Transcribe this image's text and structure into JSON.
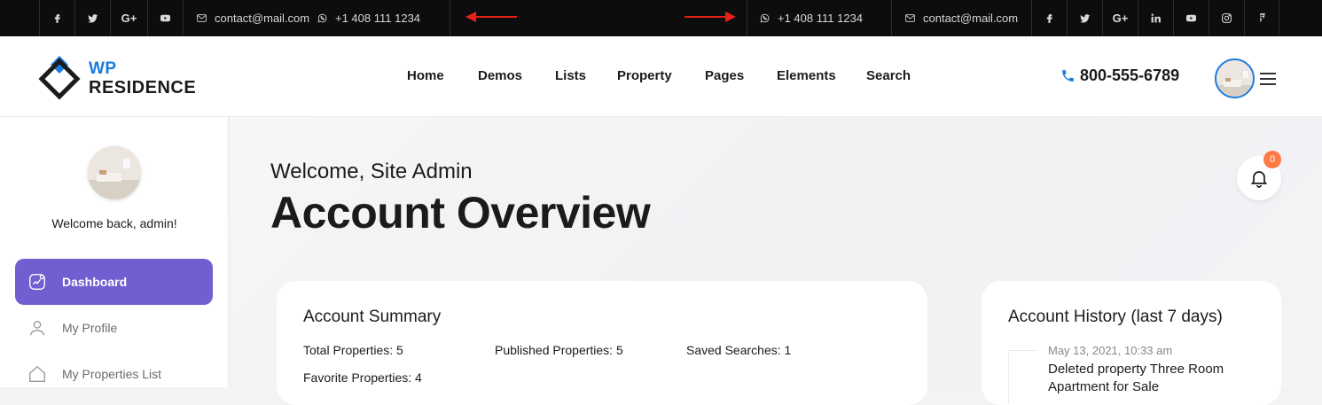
{
  "topbar": {
    "left_contact_email": "contact@mail.com",
    "left_contact_phone": "+1 408 111 1234",
    "right_contact_phone": "+1 408 111 1234",
    "right_contact_email": "contact@mail.com",
    "left_social": [
      "facebook-icon",
      "twitter-icon",
      "google-plus-icon",
      "youtube-icon"
    ],
    "right_social": [
      "facebook-icon",
      "twitter-icon",
      "google-plus-icon",
      "linkedin-icon",
      "youtube-icon",
      "instagram-icon",
      "foursquare-icon"
    ],
    "arrow_color": "#e8201a"
  },
  "header": {
    "logo_line1": "WP",
    "logo_line2": "RESIDENCE",
    "nav": [
      "Home",
      "Demos",
      "Lists",
      "Property",
      "Pages",
      "Elements",
      "Search"
    ],
    "phone": "800-555-6789",
    "accent": "#1d7be0"
  },
  "sidebar": {
    "welcome_back": "Welcome back, admin!",
    "items": [
      {
        "label": "Dashboard",
        "icon": "chart-icon",
        "active": true
      },
      {
        "label": "My Profile",
        "icon": "user-icon",
        "active": false
      },
      {
        "label": "My Properties List",
        "icon": "home-icon",
        "active": false
      }
    ],
    "active_color": "#6f5fd0"
  },
  "main": {
    "welcome": "Welcome, Site Admin",
    "title": "Account Overview",
    "notification_count": "0",
    "summary": {
      "title": "Account Summary",
      "total_properties": "Total Properties: 5",
      "published_properties": "Published Properties: 5",
      "saved_searches": "Saved Searches: 1",
      "favorite_properties": "Favorite Properties: 4"
    },
    "history": {
      "title": "Account History (last 7 days)",
      "entries": [
        {
          "date": "May 13, 2021, 10:33 am",
          "text": "Deleted property Three Room Apartment for Sale"
        }
      ]
    }
  }
}
